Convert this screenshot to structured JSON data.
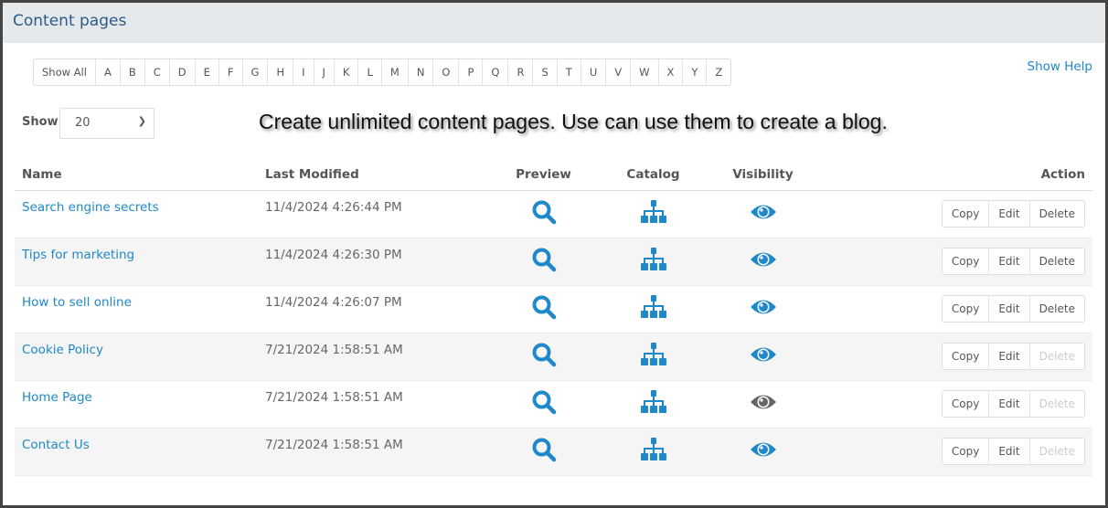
{
  "header": {
    "title": "Content pages"
  },
  "alphabet": [
    "Show All",
    "A",
    "B",
    "C",
    "D",
    "E",
    "F",
    "G",
    "H",
    "I",
    "J",
    "K",
    "L",
    "M",
    "N",
    "O",
    "P",
    "Q",
    "R",
    "S",
    "T",
    "U",
    "V",
    "W",
    "X",
    "Y",
    "Z"
  ],
  "help_label": "Show Help",
  "show": {
    "label": "Show",
    "value": "20"
  },
  "promo": "Create unlimited content pages. Use can use them to create a blog.",
  "columns": {
    "name": "Name",
    "modified": "Last Modified",
    "preview": "Preview",
    "catalog": "Catalog",
    "visibility": "Visibility",
    "action": "Action"
  },
  "actions": {
    "copy": "Copy",
    "edit": "Edit",
    "delete": "Delete"
  },
  "colors": {
    "accent": "#1e88c8",
    "hidden": "#666666"
  },
  "rows": [
    {
      "name": "Search engine secrets",
      "modified": "11/4/2024 4:26:44 PM",
      "visible": true,
      "delete_enabled": true
    },
    {
      "name": "Tips for marketing",
      "modified": "11/4/2024 4:26:30 PM",
      "visible": true,
      "delete_enabled": true
    },
    {
      "name": "How to sell online",
      "modified": "11/4/2024 4:26:07 PM",
      "visible": true,
      "delete_enabled": true
    },
    {
      "name": "Cookie Policy",
      "modified": "7/21/2024 1:58:51 AM",
      "visible": true,
      "delete_enabled": false
    },
    {
      "name": "Home Page",
      "modified": "7/21/2024 1:58:51 AM",
      "visible": false,
      "delete_enabled": false
    },
    {
      "name": "Contact Us",
      "modified": "7/21/2024 1:58:51 AM",
      "visible": true,
      "delete_enabled": false
    }
  ]
}
